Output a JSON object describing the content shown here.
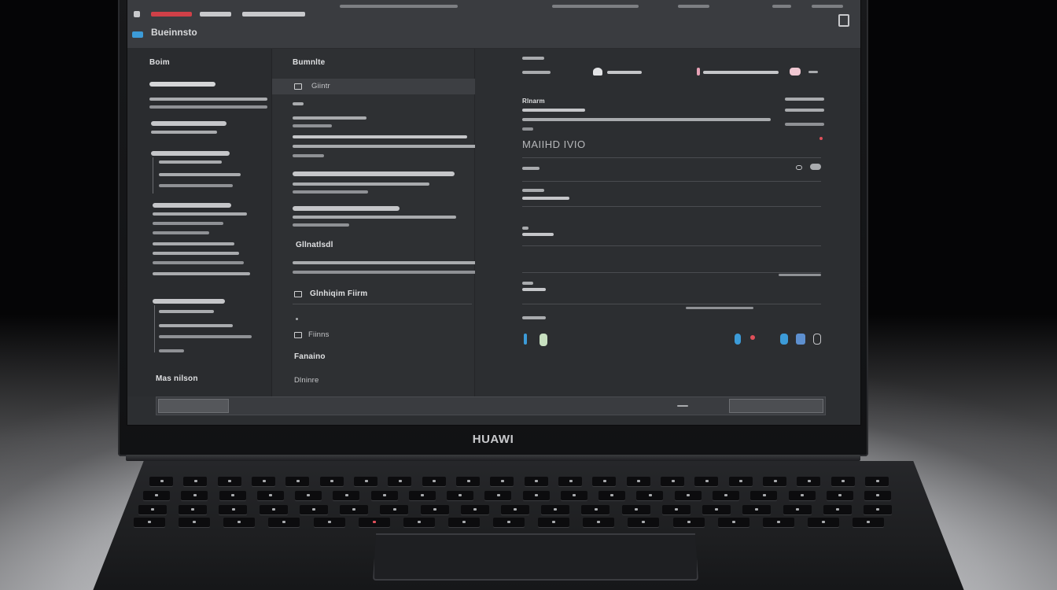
{
  "scene": {
    "brand_label": "HUAWI",
    "device": "laptop",
    "colors": {
      "screen_bg": "#2c2e31",
      "topbar_bg": "#3a3c40",
      "accent_blue": "#3c9bd8",
      "accent_red": "#e0505a",
      "accent_pink": "#e8a2b6",
      "desk_light": "#d9dadd"
    }
  },
  "screen": {
    "topbar": {
      "title": "Bueinnsto"
    },
    "left_panel": {
      "header": "Boim",
      "footer_item": "Mas nilson"
    },
    "middle_panel": {
      "header": "Bumnlte",
      "selected_item": "Giintr",
      "section": "Gllnatlsdl",
      "action_item": "Glnhiqim Fiirm",
      "bottom_items": [
        "Fiinns",
        "Fanaino",
        "Dlninre"
      ]
    },
    "right_panel": {
      "header_label": "Rlnarm",
      "title": "MAIIHD IVIO"
    }
  }
}
